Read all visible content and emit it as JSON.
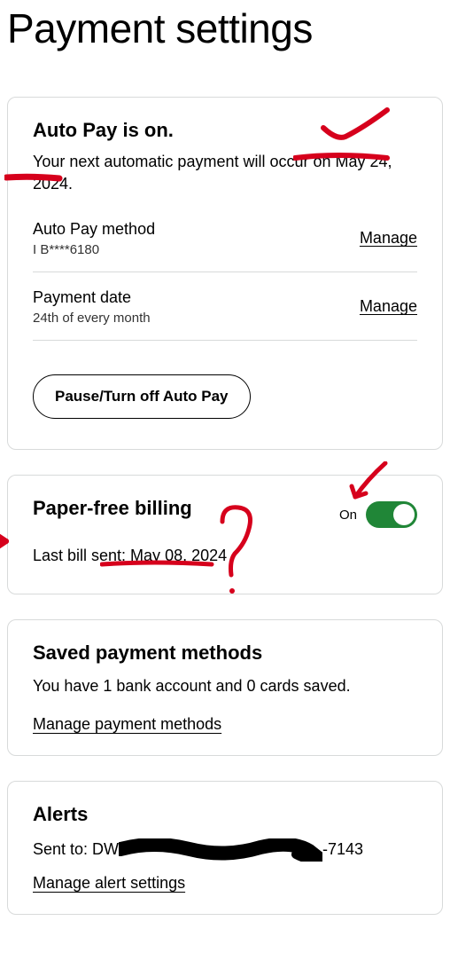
{
  "page": {
    "title": "Payment settings"
  },
  "autopay": {
    "title": "Auto Pay is on.",
    "next_payment_text": "Your next automatic payment will occur on May 24, 2024.",
    "method_label": "Auto Pay method",
    "method_value": "I B****6180",
    "manage_method": "Manage",
    "date_label": "Payment date",
    "date_value": "24th of every month",
    "manage_date": "Manage",
    "pause_button": "Pause/Turn off Auto Pay"
  },
  "paperfree": {
    "title": "Paper-free billing",
    "toggle_state_label": "On",
    "last_bill": "Last bill sent: May 08, 2024"
  },
  "saved_methods": {
    "title": "Saved payment methods",
    "summary": "You have 1 bank account and 0 cards saved.",
    "manage_link": "Manage payment methods"
  },
  "alerts": {
    "title": "Alerts",
    "sent_prefix": "Sent to: DW",
    "sent_suffix": "-7143",
    "manage_link": "Manage alert settings"
  }
}
